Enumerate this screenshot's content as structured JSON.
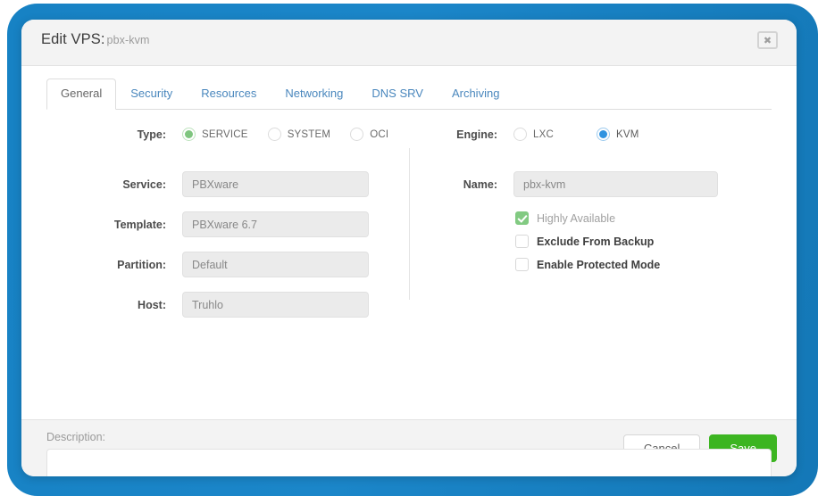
{
  "modal": {
    "title_main": "Edit VPS:",
    "title_sub": "pbx-kvm",
    "close_icon": "close-icon",
    "close_glyph": "✖"
  },
  "tabs": [
    {
      "label": "General",
      "active": true
    },
    {
      "label": "Security",
      "active": false
    },
    {
      "label": "Resources",
      "active": false
    },
    {
      "label": "Networking",
      "active": false
    },
    {
      "label": "DNS SRV",
      "active": false
    },
    {
      "label": "Archiving",
      "active": false
    }
  ],
  "form": {
    "type": {
      "label": "Type:",
      "options": [
        {
          "label": "SERVICE",
          "selected": true
        },
        {
          "label": "SYSTEM",
          "selected": false
        },
        {
          "label": "OCI",
          "selected": false
        }
      ]
    },
    "engine": {
      "label": "Engine:",
      "options": [
        {
          "label": "LXC",
          "selected": false
        },
        {
          "label": "KVM",
          "selected": true
        }
      ]
    },
    "service": {
      "label": "Service:",
      "value": "PBXware"
    },
    "template": {
      "label": "Template:",
      "value": "PBXware 6.7"
    },
    "partition": {
      "label": "Partition:",
      "value": "Default"
    },
    "host": {
      "label": "Host:",
      "value": "Truhlo"
    },
    "name": {
      "label": "Name:",
      "value": "pbx-kvm"
    },
    "checkboxes": [
      {
        "label": "Highly Available",
        "checked": true,
        "disabled": true
      },
      {
        "label": "Exclude From Backup",
        "checked": false,
        "disabled": false
      },
      {
        "label": "Enable Protected Mode",
        "checked": false,
        "disabled": false
      }
    ],
    "description": {
      "label": "Description:",
      "value": "",
      "placeholder": ""
    }
  },
  "footer": {
    "cancel_label": "Cancel",
    "save_label": "Save"
  },
  "colors": {
    "backdrop_blue": "#1782c4",
    "save_green": "#3cb521",
    "radio_green": "#7fc57f",
    "radio_blue": "#2f93e0",
    "checkbox_green": "#82ca82",
    "tab_link": "#4a87bd"
  }
}
